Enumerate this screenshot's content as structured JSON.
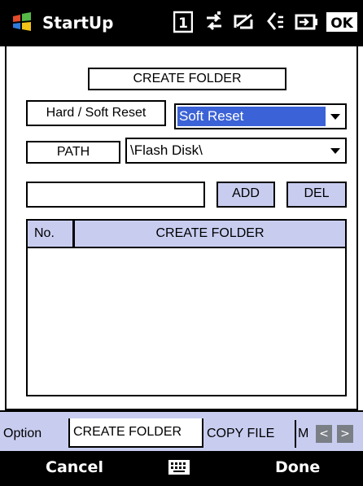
{
  "status_bar": {
    "title": "StartUp",
    "icons": [
      "windows-flag-icon",
      "sim-1-icon",
      "data-sync-icon",
      "no-signal-icon",
      "volume-mute-icon",
      "battery-icon",
      "ok-icon"
    ],
    "ok_label": "OK",
    "sim_label": "1"
  },
  "form": {
    "heading": "CREATE FOLDER",
    "reset_label": "Hard / Soft Reset",
    "reset_value": "Soft Reset",
    "path_label": "PATH",
    "path_value": "\\Flash Disk\\",
    "new_folder_value": "",
    "add_label": "ADD",
    "del_label": "DEL"
  },
  "table": {
    "columns": [
      "No.",
      "CREATE FOLDER"
    ],
    "rows": []
  },
  "tabs": {
    "items": [
      "Option",
      "CREATE FOLDER",
      "COPY FILE",
      "M"
    ],
    "active_index": 1,
    "scroll_left": "<",
    "scroll_right": ">"
  },
  "softkeys": {
    "left": "Cancel",
    "right": "Done"
  },
  "colors": {
    "accent": "#c8cdf0",
    "selection": "#3b62d6",
    "bars": "#000000"
  }
}
